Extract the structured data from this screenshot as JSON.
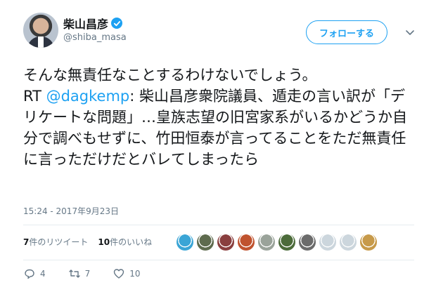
{
  "user": {
    "display_name": "柴山昌彦",
    "handle": "@shiba_masa",
    "follow_label": "フォローする"
  },
  "tweet": {
    "text_line1": "そんな無責任なことするわけないでしょう。",
    "rt_prefix": "RT ",
    "mention": "@dagkemp",
    "text_after_mention": ": 柴山昌彦衆院議員、遁走の言い訳が「デリケートな問題」…皇族志望の旧宮家系がいるかどうか自分で調べもせずに、竹田恒泰が言ってることをただ無責任に言っただけだとバレてしまったら",
    "timestamp": "15:24 - 2017年9月23日"
  },
  "stats": {
    "retweets_count": "7",
    "retweets_label": "件のリツイート",
    "likes_count": "10",
    "likes_label": "件のいいね"
  },
  "likers": [
    "#3aa5d6",
    "#5e6b4e",
    "#8a3f3f",
    "#c0532f",
    "#9aa39a",
    "#4c6b3a",
    "#6b6b6b",
    "#ccd6dd",
    "#ccd6dd",
    "#c79a4a"
  ],
  "actions": {
    "replies": "4",
    "retweets": "7",
    "likes": "10"
  },
  "colors": {
    "accent": "#1da1f2",
    "muted": "#657786"
  }
}
